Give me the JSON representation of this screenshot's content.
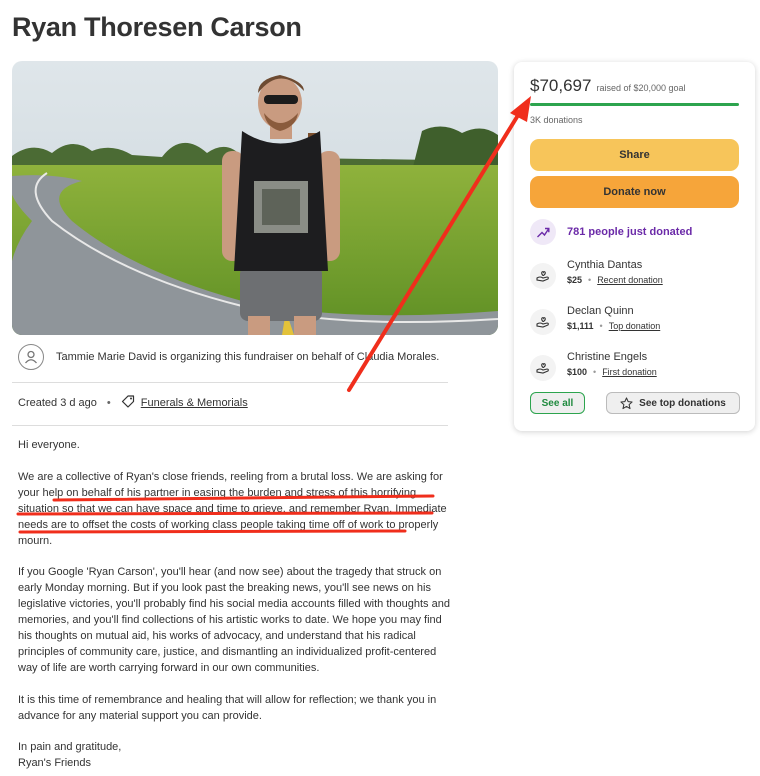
{
  "page": {
    "title": "Ryan Thoresen Carson"
  },
  "organizer": {
    "text": "Tammie Marie David is organizing this fundraiser on behalf of Claudia Morales."
  },
  "meta": {
    "created": "Created 3 d ago",
    "category": "Funerals & Memorials"
  },
  "story": {
    "paragraphs": [
      "Hi everyone.",
      "We are a collective of Ryan's close friends, reeling from a brutal loss. We are asking for your help on behalf of his partner in easing the burden and stress of this horrifying situation so that we can have space and time to grieve, and remember Ryan. Immediate needs are to offset the costs of working class people taking time off of work to properly mourn.",
      "If you Google 'Ryan Carson', you'll hear (and now see) about the tragedy that struck on early Monday morning. But if you look past the breaking news, you'll see news on his legislative victories, you'll probably find his social media accounts filled with thoughts and memories, and you'll find collections of his artistic works to date. We hope you may find his thoughts on mutual aid, his works of advocacy, and understand that his radical principles of community care, justice, and dismantling an individualized profit-centered way of life are worth carrying forward in our own communities.",
      "It is this time of remembrance and healing that will allow for reflection; we thank you in advance for any material support you can provide.",
      "In pain and gratitude,\nRyan's Friends"
    ]
  },
  "donation_card": {
    "raised": "$70,697",
    "goal_text": "raised of $20,000 goal",
    "progress_fraction": 1.0,
    "donations_count": "3K donations",
    "share_label": "Share",
    "donate_label": "Donate now",
    "trend_text": "781 people just donated",
    "donors": [
      {
        "name": "Cynthia Dantas",
        "amount": "$25",
        "label": "Recent donation"
      },
      {
        "name": "Declan Quinn",
        "amount": "$1,111",
        "label": "Top donation"
      },
      {
        "name": "Christine Engels",
        "amount": "$100",
        "label": "First donation"
      }
    ],
    "see_all_label": "See all",
    "see_top_label": "See top donations"
  },
  "colors": {
    "progress": "#2da44e",
    "share_button": "#f7c55a",
    "donate_button": "#f6a53a",
    "trend_purple": "#6b2aa8",
    "annotation_red": "#f02e1c"
  },
  "icons": [
    "user-icon",
    "tag-icon",
    "trend-up-icon",
    "donation-hand-icon",
    "star-icon"
  ]
}
